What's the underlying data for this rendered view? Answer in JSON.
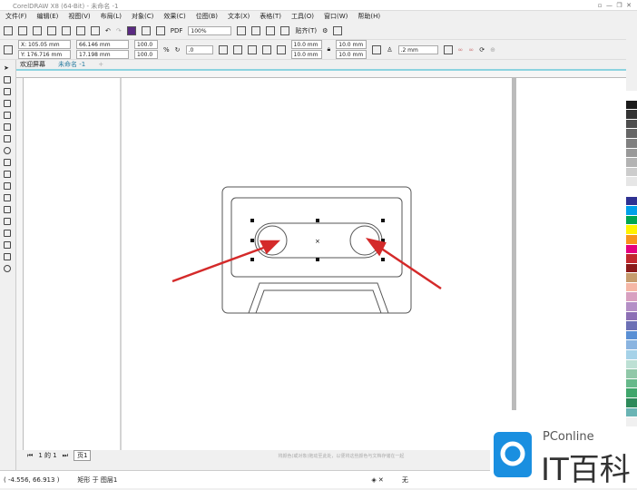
{
  "window": {
    "title": "CorelDRAW X8 (64-Bit) - 未命名 -1"
  },
  "menu": [
    "文件(F)",
    "编辑(E)",
    "视图(V)",
    "布局(L)",
    "对象(C)",
    "效果(C)",
    "位图(B)",
    "文本(X)",
    "表格(T)",
    "工具(O)",
    "窗口(W)",
    "帮助(H)"
  ],
  "toolbar": {
    "zoom": "100%",
    "snap": "贴齐(T)"
  },
  "property_bar": {
    "x": "X: 105.05 mm",
    "y": "Y: 176.716 mm",
    "width": "66.146 mm",
    "height": "17.198 mm",
    "scale_w": "100.0",
    "scale_h": "100.0",
    "unit": "%",
    "rotation": ".0",
    "corner1": "10.0 mm",
    "corner2": "10.0 mm",
    "corner3": "10.0 mm",
    "corner4": "10.0 mm",
    "outline": ".2 mm"
  },
  "tabs": [
    "欢迎屏幕",
    "未命名 -1"
  ],
  "page_nav": {
    "text": "1 的 1",
    "page": "页1"
  },
  "status": {
    "coords": "( -4.556, 66.913 )",
    "object": "矩形 于 图层1",
    "fill": "无",
    "hint": "将颜色(或对象)拖动至此处，以便将这些颜色与文档存储在一起"
  },
  "watermark": {
    "brand": "PConline",
    "sub": "IT百科"
  },
  "palette": [
    "#ffffff",
    "#1a1a1a",
    "#333",
    "#4d4d4d",
    "#666",
    "#808080",
    "#999",
    "#b3b3b3",
    "#ccc",
    "#e6e6e6",
    "#fff",
    "#2e3192",
    "#00a0e9",
    "#00a651",
    "#fff200",
    "#f7941d",
    "#e4007f",
    "#c1272d",
    "#8b1a1a",
    "#c69c6d",
    "#f5b7a6",
    "#d8a0c0",
    "#b48fc6",
    "#8c6fb5",
    "#6c6fb5",
    "#5a8fd4",
    "#8ab4e0",
    "#a6d2e8",
    "#bde0d4",
    "#90c8a8",
    "#66b98a",
    "#3fa66b",
    "#2d8a5a",
    "#6ab4b4"
  ],
  "colors": {
    "accent": "#8cd3e0",
    "arrow": "#d42a2a"
  }
}
